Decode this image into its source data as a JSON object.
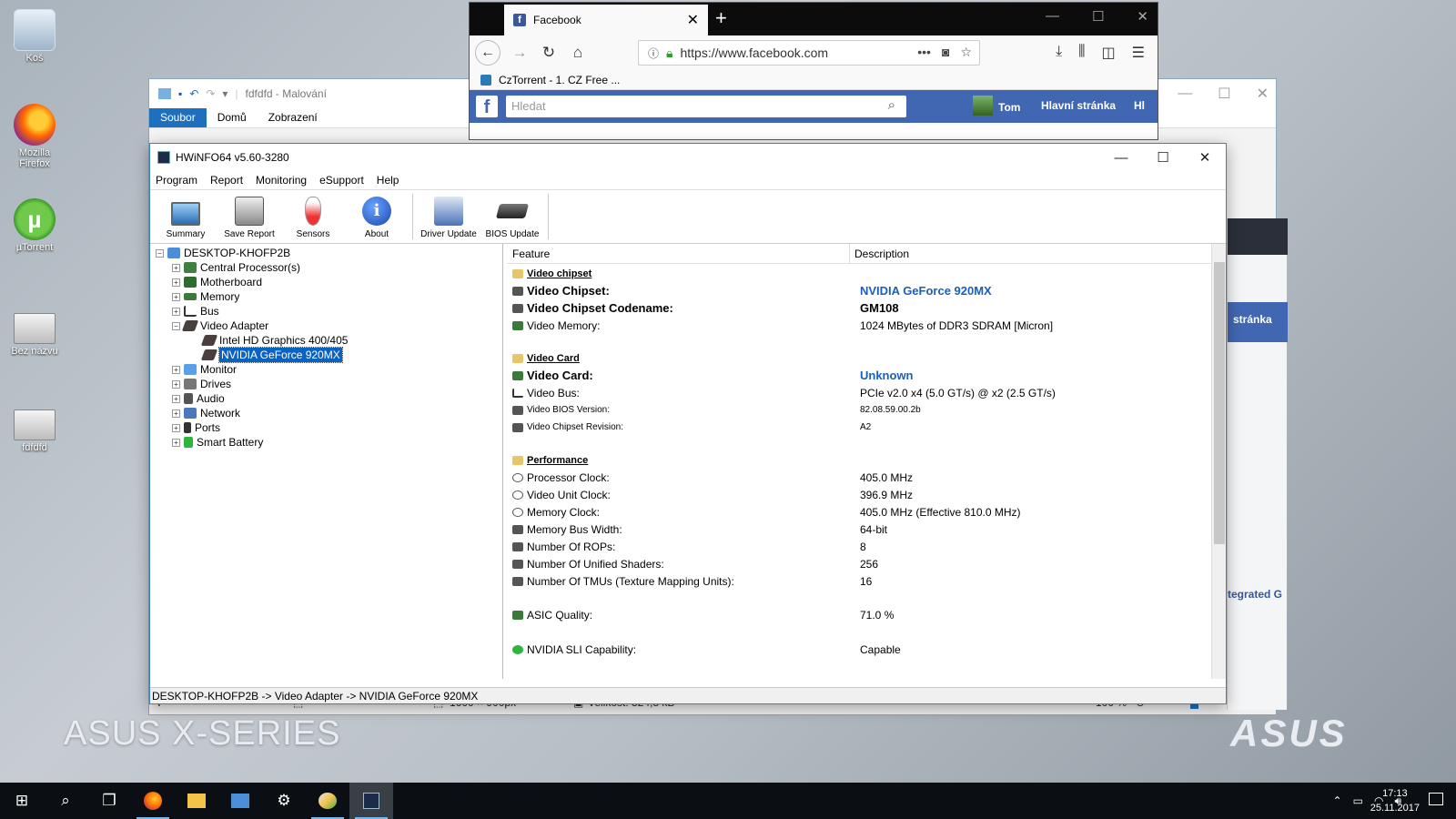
{
  "desktop": {
    "icons": [
      {
        "label": "Koš",
        "icon": "recycle-bin-icon"
      },
      {
        "label": "Mozilla Firefox",
        "icon": "firefox-icon"
      },
      {
        "label": "µTorrent",
        "icon": "utorrent-icon"
      },
      {
        "label": "Bez názvu",
        "icon": "image-file-icon"
      },
      {
        "label": "fdfdfd",
        "icon": "image-file-icon"
      }
    ],
    "brand_left": "ASUS X-SERIES",
    "brand_right": "ASUS"
  },
  "paint": {
    "title": "fdfdfd - Malování",
    "tabs": [
      "Soubor",
      "Domů",
      "Zobrazení"
    ],
    "status": {
      "dimensions": "1600 × 900px",
      "size": "Velikost: 324,8 kB",
      "zoom": "100 %"
    }
  },
  "firefox": {
    "tab_title": "Facebook",
    "url": "https://www.facebook.com",
    "bookmark": "CzTorrent - 1. CZ Free ...",
    "fb": {
      "search_placeholder": "Hledat",
      "user": "Tom",
      "home": "Hlavní stránka",
      "more": "Hl"
    },
    "peek": {
      "blue_text": "stránka",
      "link_text": "tegrated G"
    }
  },
  "hwinfo": {
    "title": "HWiNFO64 v5.60-3280",
    "menu": [
      "Program",
      "Report",
      "Monitoring",
      "eSupport",
      "Help"
    ],
    "toolbar": [
      "Summary",
      "Save Report",
      "Sensors",
      "About",
      "Driver Update",
      "BIOS Update"
    ],
    "tree": {
      "root": "DESKTOP-KHOFP2B",
      "items": [
        "Central Processor(s)",
        "Motherboard",
        "Memory",
        "Bus",
        "Video Adapter",
        "Intel HD Graphics 400/405",
        "NVIDIA GeForce 920MX",
        "Monitor",
        "Drives",
        "Audio",
        "Network",
        "Ports",
        "Smart Battery"
      ]
    },
    "columns": {
      "feature": "Feature",
      "description": "Description"
    },
    "rows": [
      {
        "feature": "Video chipset",
        "value": ""
      },
      {
        "feature": "Video Chipset:",
        "value": "NVIDIA GeForce 920MX"
      },
      {
        "feature": "Video Chipset Codename:",
        "value": "GM108"
      },
      {
        "feature": "Video Memory:",
        "value": "1024 MBytes of DDR3 SDRAM [Micron]"
      },
      {
        "feature": "Video Card",
        "value": ""
      },
      {
        "feature": "Video Card:",
        "value": "Unknown"
      },
      {
        "feature": "Video Bus:",
        "value": "PCIe v2.0 x4 (5.0 GT/s) @ x2 (2.5 GT/s)"
      },
      {
        "feature": "Video BIOS Version:",
        "value": "82.08.59.00.2b"
      },
      {
        "feature": "Video Chipset Revision:",
        "value": "A2"
      },
      {
        "feature": "Performance",
        "value": ""
      },
      {
        "feature": "Processor Clock:",
        "value": "405.0 MHz"
      },
      {
        "feature": "Video Unit Clock:",
        "value": "396.9 MHz"
      },
      {
        "feature": "Memory Clock:",
        "value": "405.0 MHz (Effective 810.0 MHz)"
      },
      {
        "feature": "Memory Bus Width:",
        "value": "64-bit"
      },
      {
        "feature": "Number Of ROPs:",
        "value": "8"
      },
      {
        "feature": "Number Of Unified Shaders:",
        "value": "256"
      },
      {
        "feature": "Number Of TMUs (Texture Mapping Units):",
        "value": "16"
      },
      {
        "feature": "ASIC Quality:",
        "value": "71.0 %"
      },
      {
        "feature": "NVIDIA SLI Capability:",
        "value": "Capable"
      }
    ],
    "statusbar": "DESKTOP-KHOFP2B -> Video Adapter -> NVIDIA GeForce 920MX"
  },
  "taskbar": {
    "time": "17:13",
    "date": "25.11.2017"
  }
}
